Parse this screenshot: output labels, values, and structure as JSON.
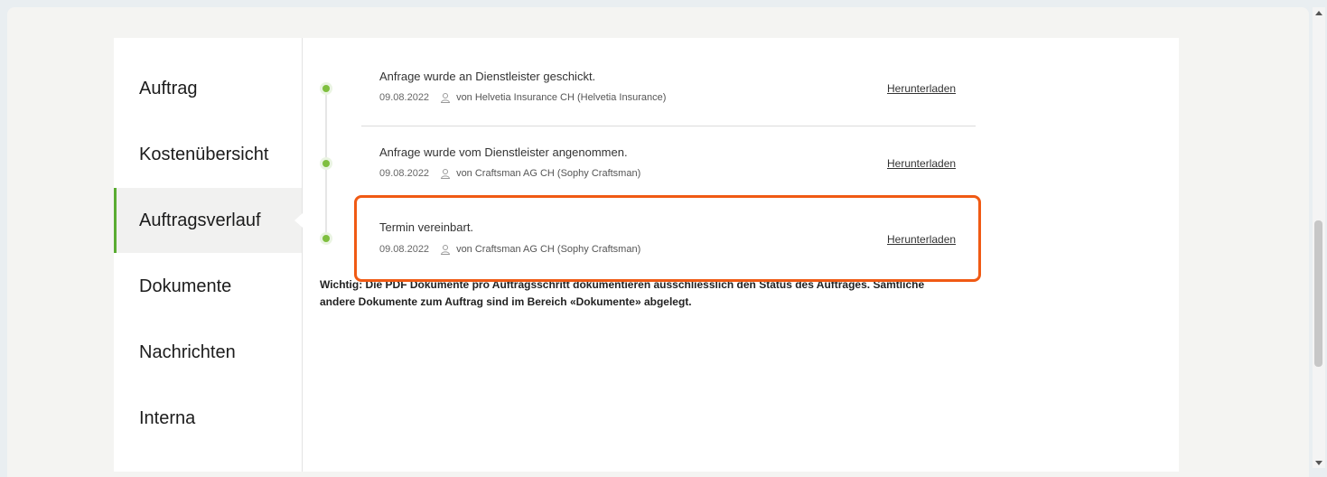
{
  "sidebar": {
    "items": [
      {
        "label": "Auftrag"
      },
      {
        "label": "Kostenübersicht"
      },
      {
        "label": "Auftragsverlauf"
      },
      {
        "label": "Dokumente"
      },
      {
        "label": "Nachrichten"
      },
      {
        "label": "Interna"
      }
    ],
    "active": "Auftragsverlauf"
  },
  "timeline": {
    "entries": [
      {
        "title": "Anfrage wurde an Dienstleister geschickt.",
        "date": "09.08.2022",
        "by": "von Helvetia Insurance CH (Helvetia Insurance)",
        "action": "Herunterladen"
      },
      {
        "title": "Anfrage wurde vom Dienstleister angenommen.",
        "date": "09.08.2022",
        "by": "von Craftsman AG CH (Sophy Craftsman)",
        "action": "Herunterladen"
      },
      {
        "title": "Termin vereinbart.",
        "date": "09.08.2022",
        "by": "von Craftsman AG CH (Sophy Craftsman)",
        "action": "Herunterladen"
      }
    ]
  },
  "note": {
    "line1": "Wichtig: Die PDF Dokumente pro Auftragsschritt dokumentieren ausschliesslich den Status des Auftrages. Sämtliche",
    "line2": "andere Dokumente zum Auftrag sind im Bereich «Dokumente» abgelegt."
  },
  "colors": {
    "accent": "#5aac32",
    "highlight": "#f05a14"
  }
}
